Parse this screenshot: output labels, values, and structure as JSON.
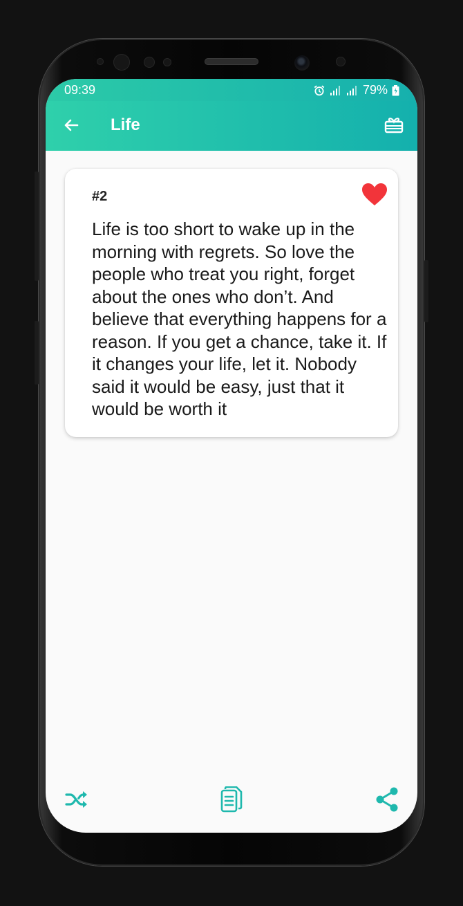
{
  "status_bar": {
    "time": "09:39",
    "battery": "79%",
    "icons": [
      "alarm-icon",
      "signal-icon",
      "signal-icon",
      "battery-icon"
    ]
  },
  "app_bar": {
    "title": "Life",
    "back_icon": "arrow-left-icon",
    "action_icon": "gift-card-icon"
  },
  "quote_card": {
    "number": "#2",
    "favorite": true,
    "favorite_icon": "heart-icon",
    "text": "Life is too short to wake up in the morning with regrets. So love the people who treat you right, forget about the ones who don’t. And believe that everything happens for a reason. If you get a chance, take it. If it changes your life, let it. Nobody said it would be easy, just that it would be worth it"
  },
  "bottom_bar": {
    "actions": [
      "shuffle-icon",
      "copy-icon",
      "share-icon"
    ]
  },
  "colors": {
    "accent": "#1eb8ad",
    "heart": "#f2343a",
    "background": "#fafafa"
  }
}
